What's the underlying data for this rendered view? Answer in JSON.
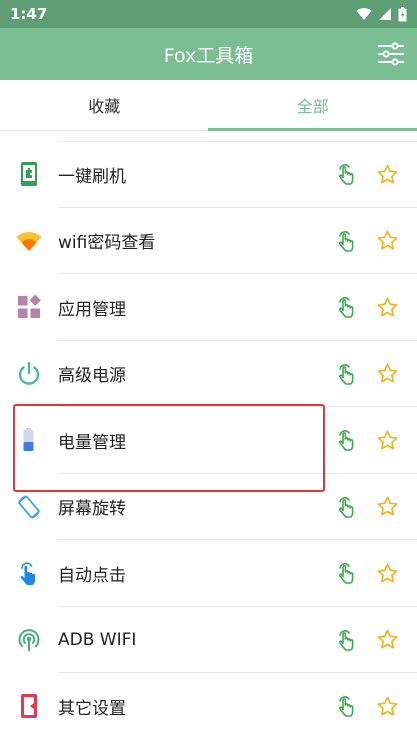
{
  "status_bar": {
    "time": "1:47"
  },
  "app_bar": {
    "title": "Fox工具箱"
  },
  "tabs": [
    {
      "label": "收藏",
      "active": false
    },
    {
      "label": "全部",
      "active": true
    }
  ],
  "items": [
    {
      "label": "一键刷机",
      "icon": "phone-puzzle-icon"
    },
    {
      "label": "wifi密码查看",
      "icon": "wifi-icon"
    },
    {
      "label": "应用管理",
      "icon": "apps-grid-icon"
    },
    {
      "label": "高级电源",
      "icon": "power-icon"
    },
    {
      "label": "电量管理",
      "icon": "battery-icon"
    },
    {
      "label": "屏幕旋转",
      "icon": "screen-rotation-icon"
    },
    {
      "label": "自动点击",
      "icon": "tap-icon"
    },
    {
      "label": "ADB WIFI",
      "icon": "wireless-signal-icon"
    },
    {
      "label": "其它设置",
      "icon": "phone-settings-icon"
    }
  ],
  "colors": {
    "status_bar": "#5e9e74",
    "app_bar": "#7cbe94",
    "accent": "#7cbe94",
    "touch_icon": "#3daa4c",
    "star_icon": "#f2b417",
    "highlight": "#e53935"
  }
}
